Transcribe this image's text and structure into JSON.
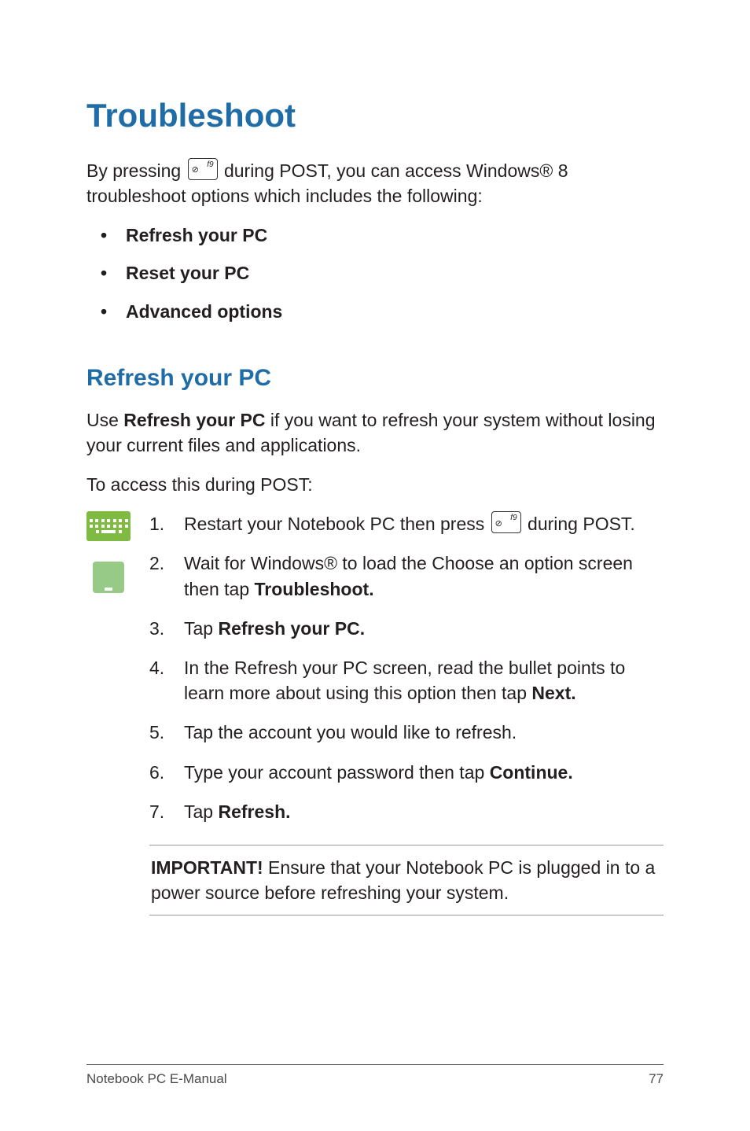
{
  "heading1": "Troubleshoot",
  "intro_before": "By pressing ",
  "intro_after": " during POST, you can access Windows® 8 troubleshoot options which includes the following:",
  "key": {
    "label": "f9",
    "glyph": "⊘"
  },
  "options": [
    "Refresh your PC",
    "Reset your PC",
    "Advanced options"
  ],
  "heading2": "Refresh your PC",
  "refresh_intro_before": "Use ",
  "refresh_intro_bold": "Refresh your PC",
  "refresh_intro_after": " if you want to refresh your system without losing your current files and applications.",
  "access_line": "To access this during POST:",
  "steps": {
    "s1_before": "Restart your Notebook PC then press ",
    "s1_after": " during POST.",
    "s2_before": "Wait for Windows® to load the Choose an option screen then tap ",
    "s2_bold": "Troubleshoot.",
    "s3_before": "Tap ",
    "s3_bold": "Refresh your PC.",
    "s4_before": "In the Refresh your PC screen, read the bullet points to learn more about using this option then tap ",
    "s4_bold": "Next.",
    "s5": "Tap the account you would like to refresh.",
    "s6_before": "Type your account password then tap ",
    "s6_bold": "Continue.",
    "s7_before": "Tap ",
    "s7_bold": "Refresh."
  },
  "important_bold": "IMPORTANT!",
  "important_text": " Ensure that your Notebook PC is plugged in to a power source before refreshing your system.",
  "footer_left": "Notebook PC E-Manual",
  "footer_right": "77"
}
